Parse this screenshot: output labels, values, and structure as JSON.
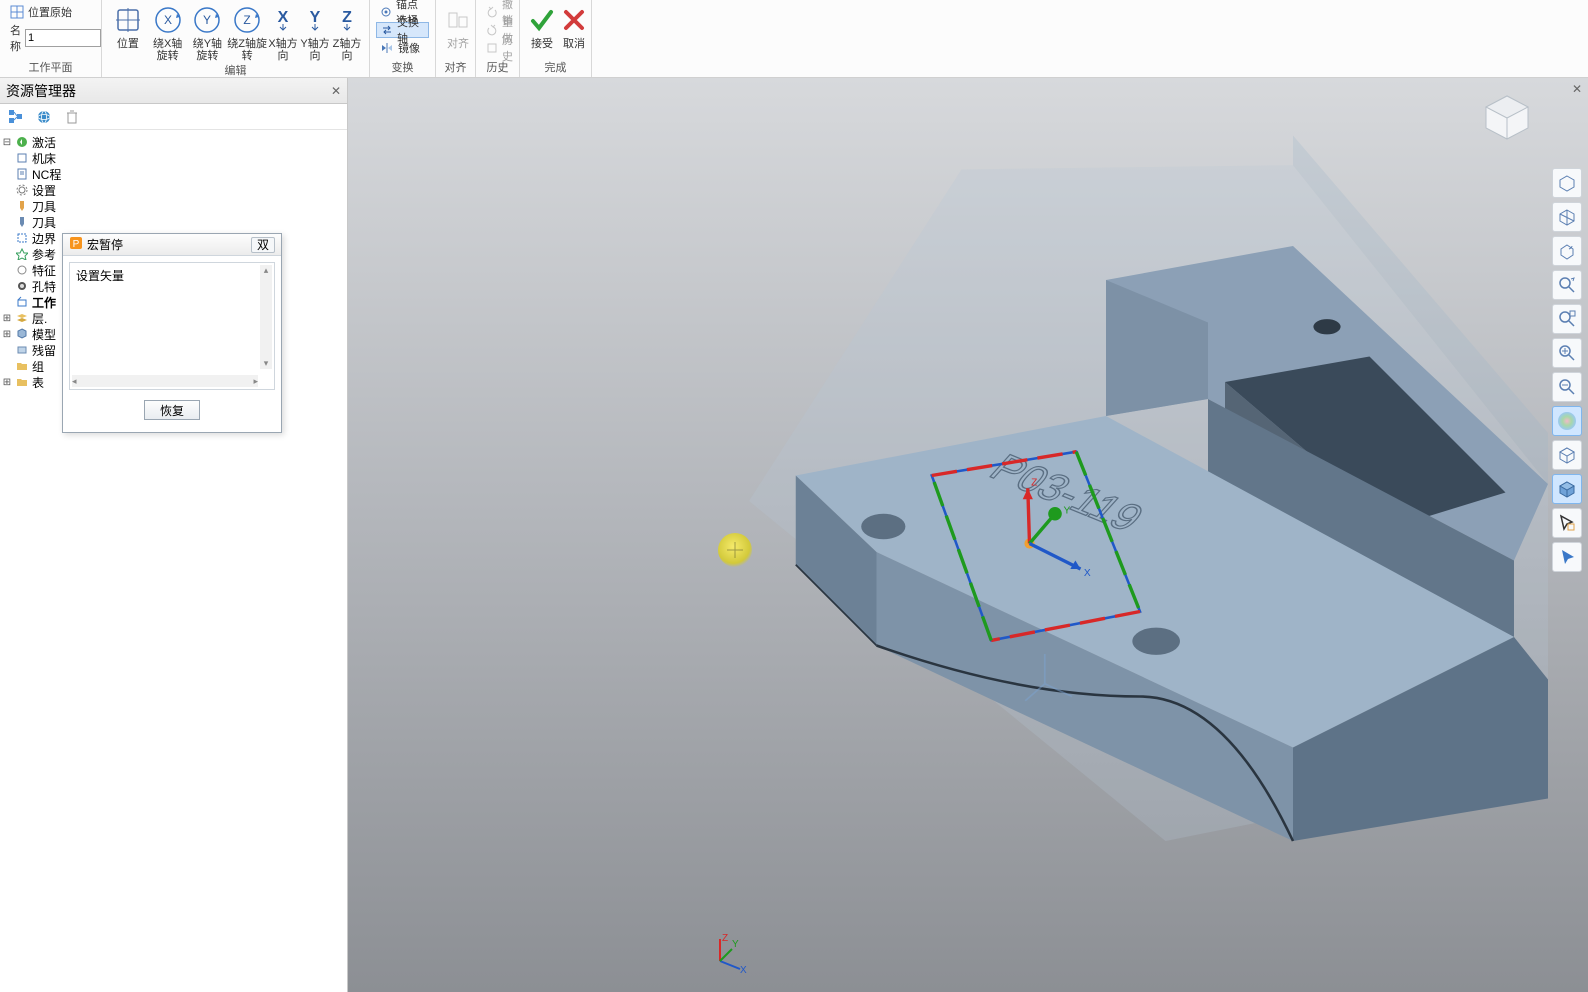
{
  "ribbon": {
    "group_workplane": "工作平面",
    "group_edit": "编辑",
    "group_transform": "变换",
    "group_align": "对齐",
    "group_history": "历史",
    "group_finish": "完成",
    "pos_origin": "位置原始",
    "name_label": "名称",
    "name_value": "1",
    "position": "位置",
    "rot_x": "绕X轴旋转",
    "rot_y": "绕Y轴旋转",
    "rot_z": "绕Z轴旋转",
    "dir_x": "X轴方向",
    "dir_y": "Y轴方向",
    "dir_z": "Z轴方向",
    "anchor_select": "锚点选择",
    "swap_axes": "交换轴",
    "mirror": "镜像",
    "align": "对齐",
    "undo": "撤销",
    "redo": "重做",
    "history": "历史",
    "accept": "接受",
    "cancel": "取消"
  },
  "res": {
    "title": "资源管理器",
    "tree": {
      "activate": "激活",
      "mach": "机床",
      "nc": "NC程",
      "settings": "设置",
      "tool1": "刀具",
      "tool2": "刀具",
      "boundary": "边界",
      "ref": "参考",
      "feature": "特征",
      "hole": "孔特",
      "work": "工作",
      "layer": "层.",
      "model": "模型",
      "stock": "残留",
      "group": "组",
      "mfg": "表"
    }
  },
  "dialog": {
    "title": "宏暂停",
    "prompt": "设置矢量",
    "restore": "恢复",
    "pin": "双"
  },
  "axes": {
    "x": "X",
    "y": "Y",
    "z": "Z"
  },
  "engraving": "P03-119"
}
